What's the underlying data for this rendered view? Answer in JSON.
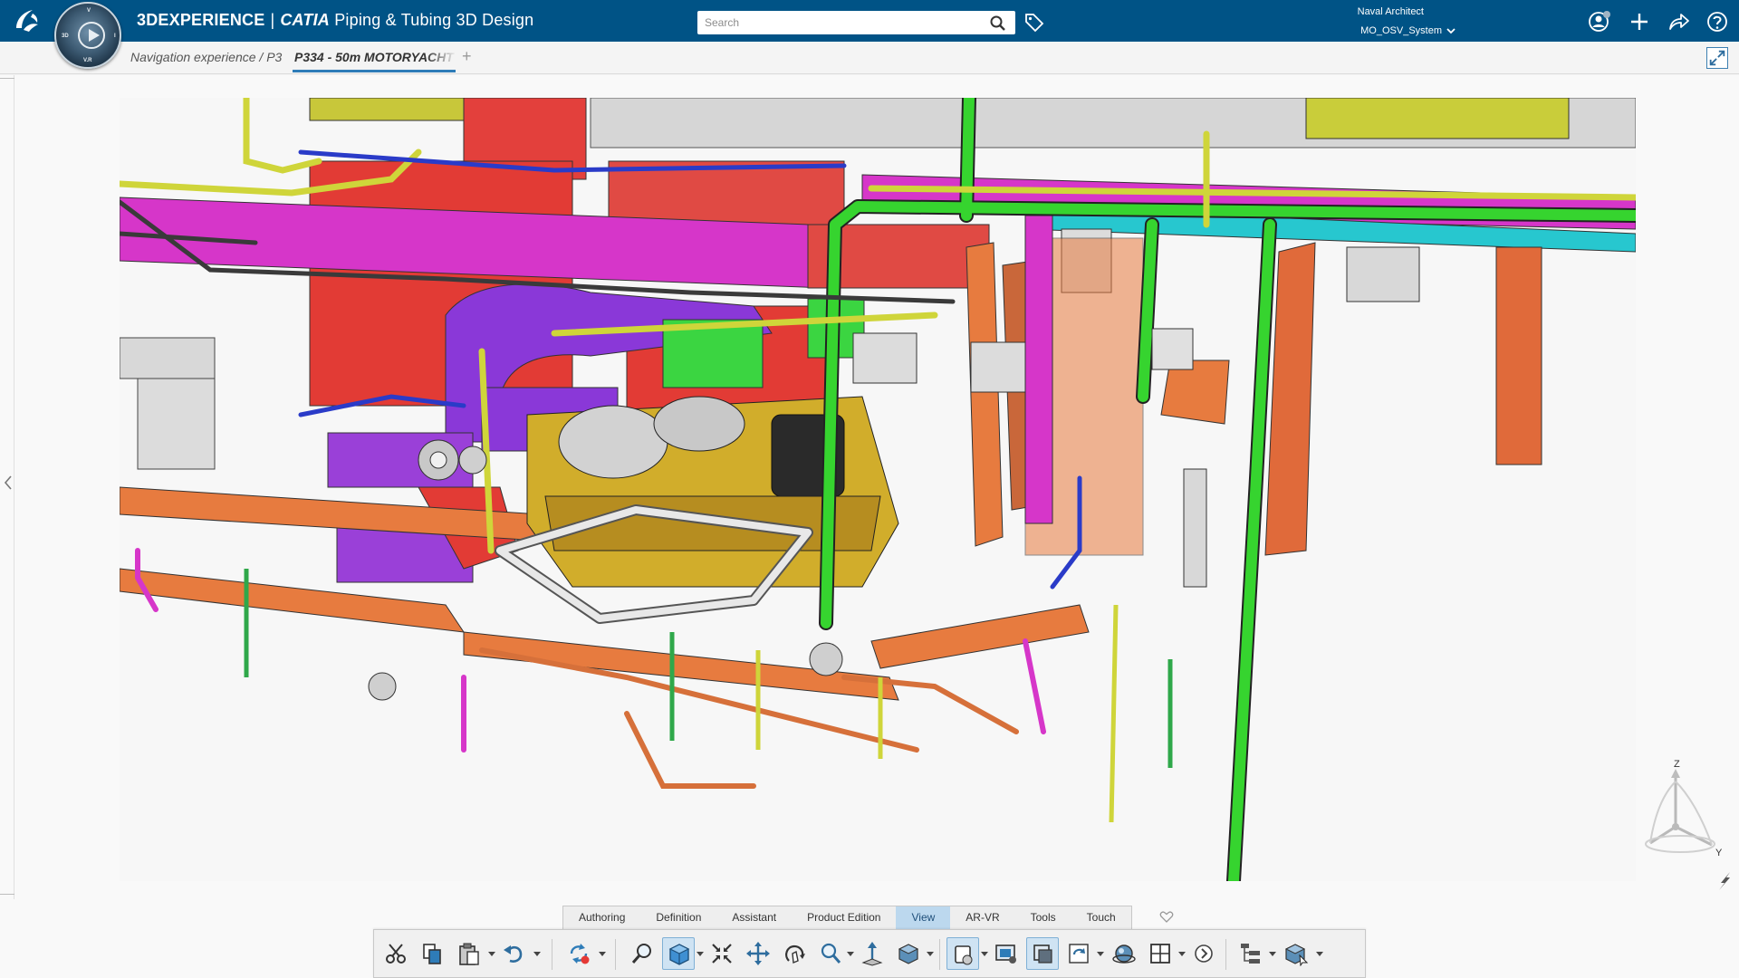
{
  "header": {
    "brand": "3DEXPERIENCE",
    "separator": "|",
    "product": "CATIA",
    "app_name": "Piping & Tubing 3D Design",
    "search": {
      "placeholder": "Search",
      "value": ""
    },
    "user": {
      "role": "Naval Architect",
      "credentials": "MO_OSV_System"
    },
    "icons": [
      "ds-logo",
      "compass-icon",
      "search-icon",
      "tag-icon",
      "profile-icon",
      "add-icon",
      "share-icon",
      "help-icon"
    ],
    "compass_labels": {
      "top": "V",
      "left": "3D",
      "bottom": "V.R",
      "right": "I"
    }
  },
  "tabs": {
    "breadcrumb": "Navigation experience / P3",
    "active": "P334 - 50m MOTORYACHT",
    "add": "+"
  },
  "viewport": {
    "compass_axes": {
      "z": "Z",
      "y": "Y"
    }
  },
  "action_bar": {
    "sections": [
      {
        "label": "Authoring",
        "active": false
      },
      {
        "label": "Definition",
        "active": false
      },
      {
        "label": "Assistant",
        "active": false
      },
      {
        "label": "Product Edition",
        "active": false
      },
      {
        "label": "View",
        "active": true
      },
      {
        "label": "AR-VR",
        "active": false
      },
      {
        "label": "Tools",
        "active": false
      },
      {
        "label": "Touch",
        "active": false
      }
    ],
    "tools": [
      "cut-icon",
      "copy-icon",
      "paste-icon",
      "undo-icon",
      "update-icon",
      "search-zoom-icon",
      "view-mode-cube-icon",
      "fit-all-icon",
      "pan-icon",
      "rotate-icon",
      "zoom-icon",
      "normal-view-icon",
      "render-style-icon",
      "cut-view-icon",
      "capture-icon",
      "selection-view-icon",
      "refresh-view-icon",
      "ambience-icon",
      "multi-view-icon",
      "more-icon",
      "tree-icon",
      "product-icon"
    ]
  },
  "colors": {
    "topbar": "#005386",
    "accent": "#2e7cb8",
    "active_section": "#bcd8ee"
  }
}
